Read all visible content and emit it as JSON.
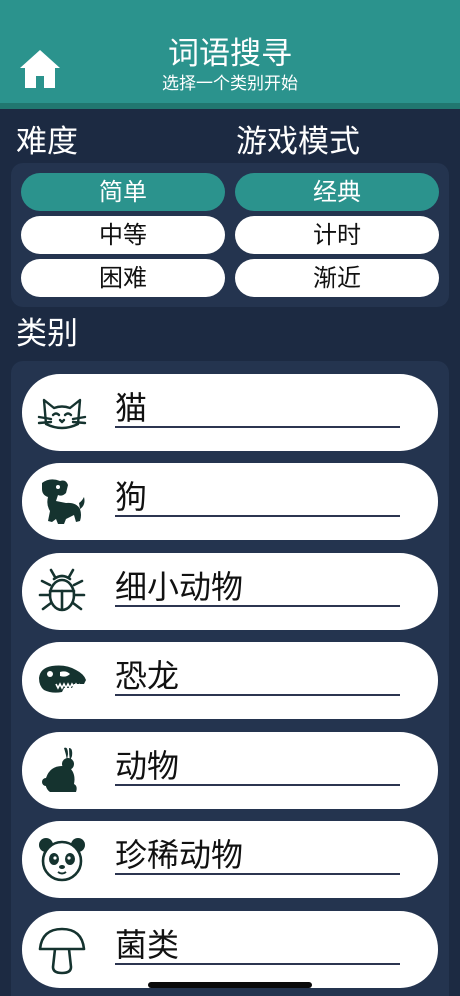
{
  "header": {
    "title": "词语搜寻",
    "subtitle": "选择一个类别开始",
    "home_icon": "home-icon",
    "color": "#2b938d"
  },
  "difficulty": {
    "label": "难度",
    "options": [
      "简单",
      "中等",
      "困难"
    ],
    "selected": "简单"
  },
  "game_mode": {
    "label": "游戏模式",
    "options": [
      "经典",
      "计时",
      "渐近"
    ],
    "selected": "经典"
  },
  "categories": {
    "label": "类别",
    "items": [
      {
        "label": "猫",
        "icon": "cat-icon"
      },
      {
        "label": "狗",
        "icon": "dog-icon"
      },
      {
        "label": "细小动物",
        "icon": "bug-icon"
      },
      {
        "label": "恐龙",
        "icon": "dinosaur-skull-icon"
      },
      {
        "label": "动物",
        "icon": "rabbit-icon"
      },
      {
        "label": "珍稀动物",
        "icon": "panda-icon"
      },
      {
        "label": "菌类",
        "icon": "mushroom-icon"
      }
    ]
  },
  "colors": {
    "background": "#1c2a42",
    "panel": "#24344f",
    "accent": "#2b938d",
    "icon": "#15332f"
  }
}
